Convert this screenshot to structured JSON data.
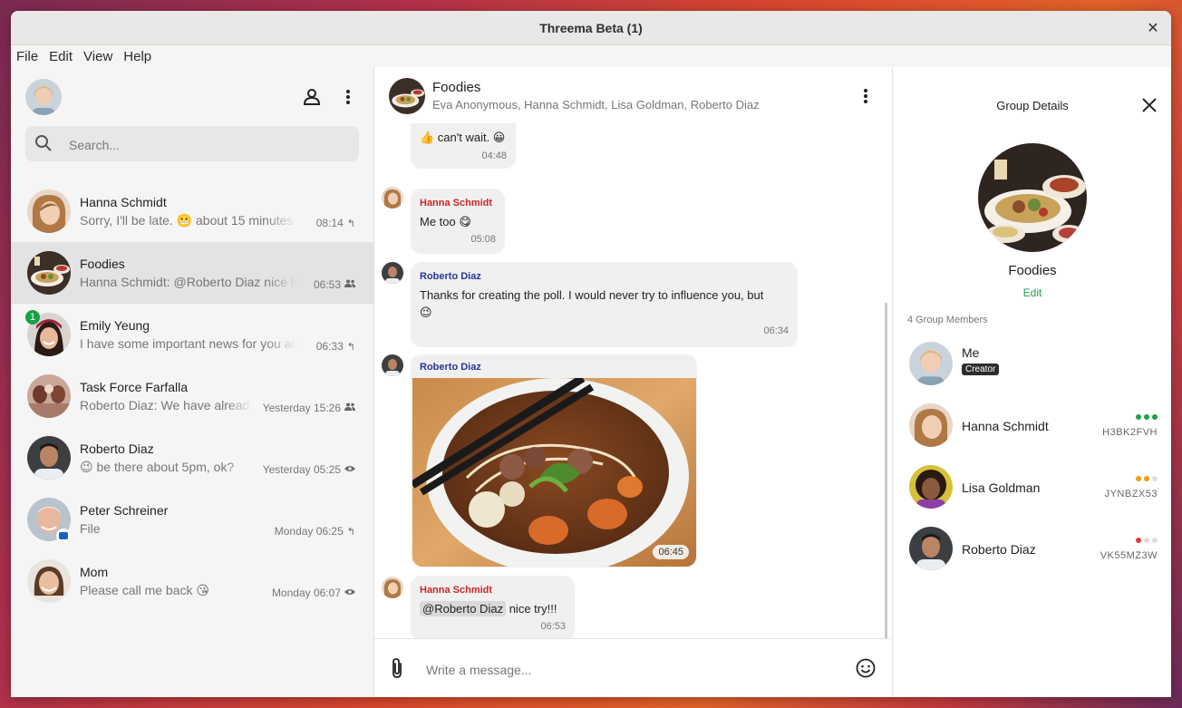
{
  "window": {
    "title": "Threema Beta (1)",
    "close_glyph": "✕"
  },
  "menu": [
    "File",
    "Edit",
    "View",
    "Help"
  ],
  "search": {
    "placeholder": "Search..."
  },
  "conversations": [
    {
      "name": "Hanna Schmidt",
      "preview": "Sorry, I'll be late. 😬 about 15 minutes",
      "time": "08:14",
      "status_icon": "reply-icon"
    },
    {
      "name": "Foodies",
      "preview": "Hanna Schmidt: @Roberto Diaz nice try!!!",
      "time": "06:53",
      "status_icon": "group-icon"
    },
    {
      "name": "Emily Yeung",
      "preview": "I have some important news for you and",
      "time": "06:33",
      "status_icon": "reply-icon",
      "unread": "1"
    },
    {
      "name": "Task Force Farfalla",
      "preview": "Roberto Diaz: We have already",
      "time": "Yesterday 15:26",
      "status_icon": "group-icon"
    },
    {
      "name": "Roberto Diaz",
      "preview": "😉 be there about 5pm, ok?",
      "time": "Yesterday 05:25",
      "status_icon": "eye-icon"
    },
    {
      "name": "Peter Schreiner",
      "preview": "File",
      "time": "Monday 06:25",
      "status_icon": "reply-icon"
    },
    {
      "name": "Mom",
      "preview": "Please call me back 😘",
      "time": "Monday 06:07",
      "status_icon": "eye-icon"
    }
  ],
  "chat": {
    "title": "Foodies",
    "members_line": "Eva Anonymous, Hanna Schmidt, Lisa Goldman, Roberto Diaz",
    "composer_placeholder": "Write a message...",
    "messages": [
      {
        "text": "👍 can't wait. 😀",
        "time": "04:48"
      },
      {
        "sender": "Hanna Schmidt",
        "text": "Me too 😋",
        "time": "05:08"
      },
      {
        "sender": "Roberto Diaz",
        "text": "Thanks for creating the poll. I would never try to influence you, but",
        "text2": "😉",
        "time": "06:34"
      },
      {
        "sender": "Roberto Diaz",
        "image": "noodle-soup-photo",
        "time": "06:45"
      },
      {
        "sender": "Hanna Schmidt",
        "mention": "@Roberto Diaz",
        "text": "nice try!!!",
        "time": "06:53"
      }
    ]
  },
  "details": {
    "title": "Group Details",
    "group_name": "Foodies",
    "edit_label": "Edit",
    "member_count": "4 Group Members",
    "members": [
      {
        "name": "Me",
        "tag": "Creator"
      },
      {
        "name": "Hanna Schmidt",
        "id": "H3BK2FVH",
        "verification": 3
      },
      {
        "name": "Lisa Goldman",
        "id": "JYNBZX53",
        "verification": 2
      },
      {
        "name": "Roberto Diaz",
        "id": "VK55MZ3W",
        "verification": 1
      }
    ]
  },
  "colors": {
    "hanna_sender": "#c62828",
    "roberto_sender": "#283593",
    "accent_green": "#1aa148",
    "verify_orange": "#f39c12",
    "verify_red": "#e53935"
  }
}
